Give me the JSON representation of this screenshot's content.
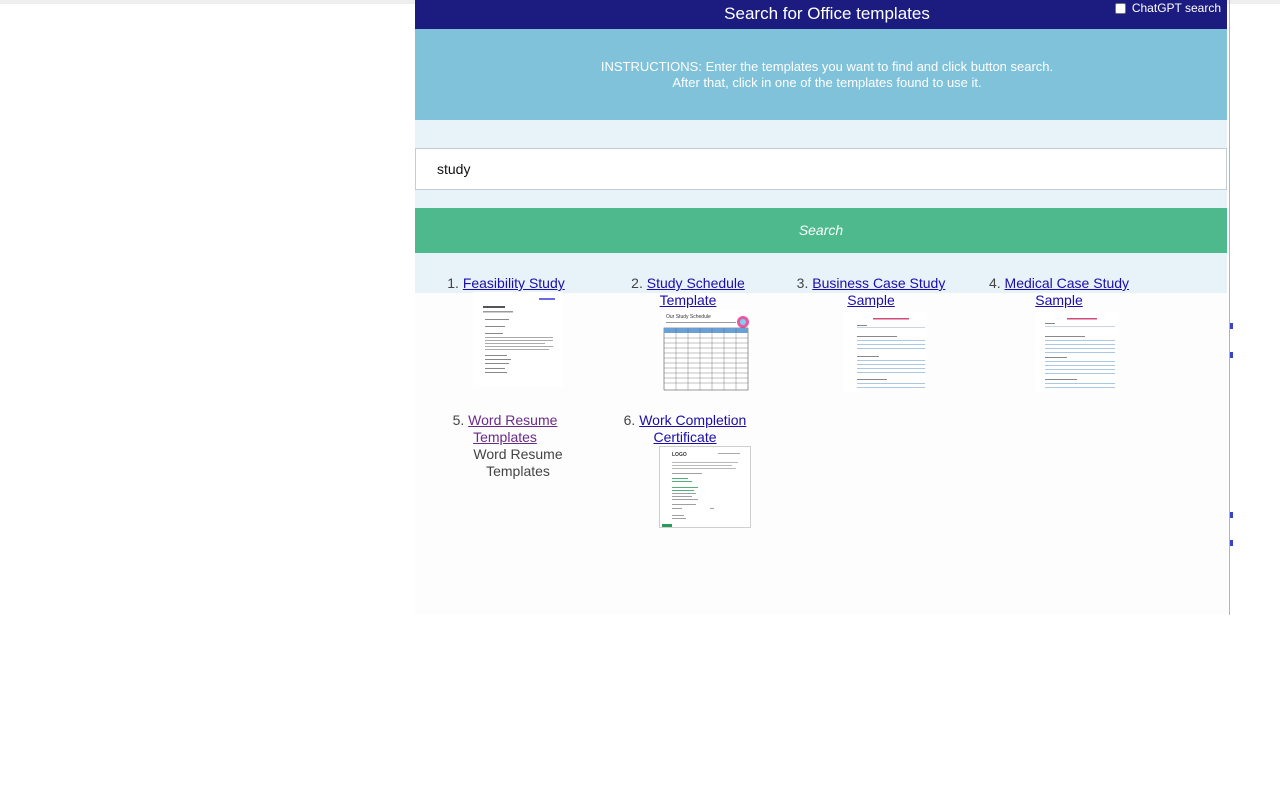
{
  "header": {
    "title": "Search for Office templates",
    "chatgpt_label": "ChatGPT search"
  },
  "instructions": {
    "line1": "INSTRUCTIONS: Enter the templates you want to find and click button search.",
    "line2": "After that, click in one of the templates found to use it."
  },
  "search": {
    "value": "study",
    "button_label": "Search"
  },
  "results": [
    {
      "num": "1.",
      "title": "Feasibility Study"
    },
    {
      "num": "2.",
      "title_line1": "Study Schedule",
      "title_line2": "Template",
      "thumb_heading": "Our Study Schedule"
    },
    {
      "num": "3.",
      "title_line1": "Business Case Study",
      "title_line2": "Sample"
    },
    {
      "num": "4.",
      "title_line1": "Medical Case Study",
      "title_line2": "Sample"
    },
    {
      "num": "5.",
      "title_line1": "Word Resume",
      "title_line2": "Templates",
      "alt_line1": "Word Resume",
      "alt_line2": "Templates"
    },
    {
      "num": "6.",
      "title_line1": "Work Completion",
      "title_line2": "Certificate",
      "thumb_logo": "LOGO"
    }
  ],
  "colors": {
    "header": "#1c1c80",
    "instructions": "#7fc2da",
    "search_button": "#4db98c",
    "link": "#1a0dab",
    "visited_link": "#6b2a8a"
  }
}
